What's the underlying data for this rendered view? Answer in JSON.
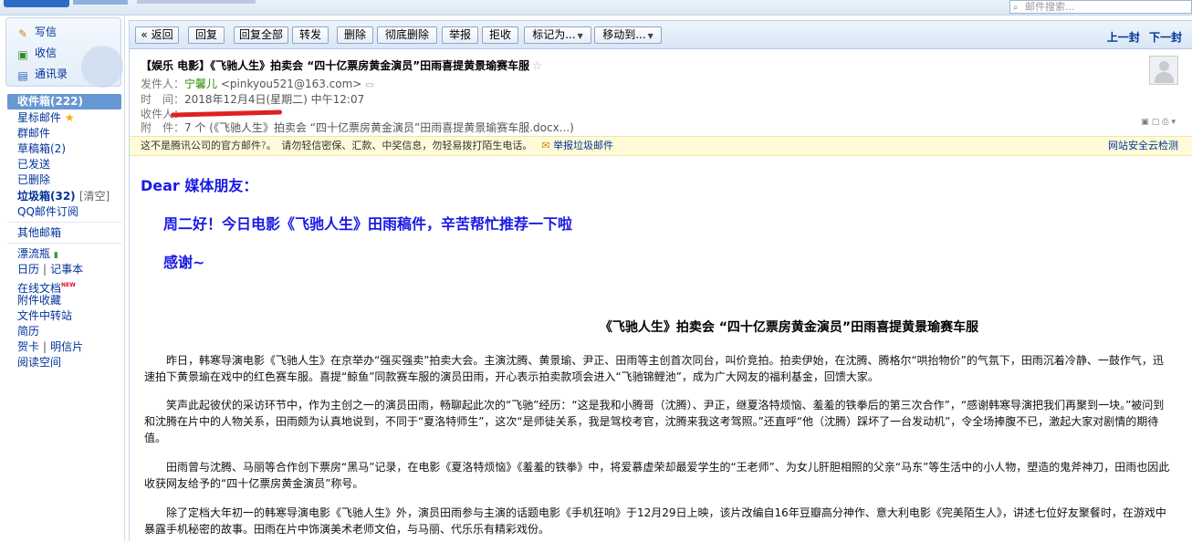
{
  "search": {
    "placeholder": "邮件搜索..."
  },
  "quick": {
    "write": "写信",
    "inbox": "收信",
    "contacts": "通讯录"
  },
  "folders": {
    "inbox": "收件箱(222)",
    "starred": "星标邮件",
    "group": "群邮件",
    "drafts": "草稿箱(2)",
    "sent": "已发送",
    "deleted": "已删除",
    "junk": "垃圾箱(32)",
    "junk_clean": "[清空]",
    "subscribe": "QQ邮件订阅",
    "other": "其他邮箱",
    "bottle": "漂流瓶",
    "calendar": "日历",
    "notes": "记事本",
    "docs": "在线文档",
    "docs_badge": "NEW",
    "attachments": "附件收藏",
    "transfer": "文件中转站",
    "resume": "简历",
    "cards": "贺卡",
    "postcards": "明信片",
    "reading": "阅读空间"
  },
  "toolbar": {
    "back": "« 返回",
    "reply": "回复",
    "reply_all": "回复全部",
    "forward": "转发",
    "delete": "删除",
    "delete_perm": "彻底删除",
    "report": "举报",
    "reject": "拒收",
    "mark_as": "标记为...",
    "move_to": "移动到...",
    "prev": "上一封",
    "next": "下一封"
  },
  "mail": {
    "subject": "【娱乐 电影】《飞驰人生》拍卖会 “四十亿票房黄金演员”田雨喜提黄景瑜赛车服",
    "from_label": "发件人：",
    "from_name": "宁馨儿",
    "from_addr": "<pinkyou521@163.com>",
    "time_label": "时　间：",
    "time_value": "2018年12月4日(星期二) 中午12:07",
    "to_label": "收件人：",
    "att_label": "附　件：",
    "att_value": "7 个 (《飞驰人生》拍卖会 “四十亿票房黄金演员”田雨喜提黄景瑜赛车服.docx...)"
  },
  "warning": {
    "text": "这不是腾讯公司的官方邮件",
    "q": "?",
    "advice": "。　请勿轻信密保、汇款、中奖信息，勿轻易拨打陌生电话。",
    "report": "举报垃圾邮件",
    "detect": "网站安全云检测"
  },
  "content": {
    "greeting": "Dear 媒体朋友：",
    "line1": "周二好！今日电影《飞驰人生》田雨稿件，辛苦帮忙推荐一下啦",
    "line2": "感谢~",
    "article_title": "《飞驰人生》拍卖会  “四十亿票房黄金演员”田雨喜提黄景瑜赛车服",
    "p1": "昨日，韩寒导演电影《飞驰人生》在京举办“强买强卖”拍卖大会。主演沈腾、黄景瑜、尹正、田雨等主创首次同台，叫价竞拍。拍卖伊始，在沈腾、腾格尔“哄抬物价”的气氛下，田雨沉着冷静、一鼓作气，迅速拍下黄景瑜在戏中的红色赛车服。喜提“鲸鱼”同款赛车服的演员田雨，开心表示拍卖款项会进入“飞驰锦鲤池”，成为广大网友的福利基金，回馈大家。",
    "p2": "笑声此起彼伏的采访环节中，作为主创之一的演员田雨，畅聊起此次的“飞驰”经历：“这是我和小腾哥（沈腾）、尹正，继夏洛特烦恼、羞羞的铁拳后的第三次合作”，“感谢韩寒导演把我们再聚到一块。”被问到和沈腾在片中的人物关系，田雨颇为认真地说到，不同于“夏洛特师生”，这次“是师徒关系，我是驾校考官，沈腾来我这考驾照。”还直呼“他（沈腾）踩坏了一台发动机”，令全场捧腹不已，激起大家对剧情的期待值。",
    "p3": "田雨曾与沈腾、马丽等合作创下票房“黑马”记录，在电影《夏洛特烦恼》《羞羞的铁拳》中，将爱慕虚荣却最爱学生的“王老师”、为女儿肝胆相照的父亲“马东”等生活中的小人物，塑造的鬼斧神刀，田雨也因此收获网友给予的“四十亿票房黄金演员”称号。",
    "p4": "除了定档大年初一的韩寒导演电影《飞驰人生》外，演员田雨参与主演的话题电影《手机狂响》于12月29日上映，该片改编自16年豆瓣高分神作、意大利电影《完美陌生人》，讲述七位好友聚餐时，在游戏中暴露手机秘密的故事。田雨在片中饰演美术老师文伯，与马丽、代乐乐有精彩戏份。"
  }
}
